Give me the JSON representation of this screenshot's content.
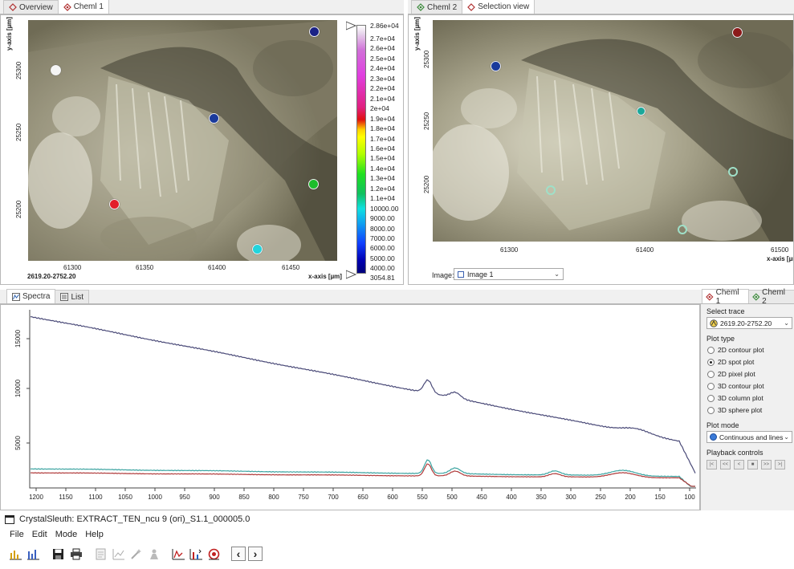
{
  "colors": {
    "dot_white": "#f4f4f4",
    "dot_navy": "#1b2286",
    "dot_blue": "#1a3a9c",
    "dot_green": "#1dbd2b",
    "dot_red": "#e21d2a",
    "dot_cyan": "#22d4dc",
    "dot_darkred": "#8c1a1a",
    "dot_teal": "#1aa89a",
    "ring": "#a7e7cf",
    "spectrum_top": "#4a4a78",
    "spectrum_teal": "#3aa3a0",
    "spectrum_red": "#b03a3a"
  },
  "left_panel": {
    "tabs": [
      {
        "label": "Overview",
        "icon": "overview-icon"
      },
      {
        "label": "Cheml 1",
        "icon": "chemical-icon"
      }
    ],
    "y_axis": {
      "label": "y-axis [µm]",
      "ticks": [
        "25300",
        "25250",
        "25200"
      ]
    },
    "x_axis": {
      "label": "x-axis [µm]",
      "ticks": [
        "61300",
        "61350",
        "61400",
        "61450"
      ]
    },
    "range_label": "2619.20-2752.20",
    "colorbar": {
      "labels": [
        "2.86e+04",
        "2.7e+04",
        "2.6e+04",
        "2.5e+04",
        "2.4e+04",
        "2.3e+04",
        "2.2e+04",
        "2.1e+04",
        "2e+04",
        "1.9e+04",
        "1.8e+04",
        "1.7e+04",
        "1.6e+04",
        "1.5e+04",
        "1.4e+04",
        "1.3e+04",
        "1.2e+04",
        "1.1e+04",
        "10000.00",
        "9000.00",
        "8000.00",
        "7000.00",
        "6000.00",
        "5000.00",
        "4000.00",
        "3054.81"
      ]
    }
  },
  "right_panel": {
    "tabs": [
      {
        "label": "Cheml 2",
        "icon": "chemical-icon"
      },
      {
        "label": "Selection view",
        "icon": "selection-icon"
      }
    ],
    "y_axis": {
      "label": "y-axis [µm]",
      "ticks": [
        "25300",
        "25250",
        "25200"
      ]
    },
    "x_axis": {
      "label": "x-axis [µm]",
      "ticks": [
        "61300",
        "61400",
        "61500"
      ]
    },
    "image_label": "Image:",
    "image_value": "Image 1"
  },
  "bottom_panel": {
    "tabs": [
      {
        "label": "Spectra",
        "icon": "spectra-icon"
      },
      {
        "label": "List",
        "icon": "list-icon"
      }
    ],
    "y_ticks": [
      "15000",
      "10000",
      "5000"
    ],
    "x_ticks": [
      "1200",
      "1150",
      "1100",
      "1050",
      "1000",
      "950",
      "900",
      "850",
      "800",
      "750",
      "700",
      "650",
      "600",
      "550",
      "500",
      "450",
      "400",
      "350",
      "300",
      "250",
      "200",
      "150",
      "100"
    ]
  },
  "side_panel": {
    "tabs": [
      {
        "label": "Cheml 1",
        "icon": "chemical-icon"
      },
      {
        "label": "Cheml 2",
        "icon": "chemical-icon"
      }
    ],
    "select_trace_label": "Select trace",
    "trace_value": "2619.20-2752.20",
    "plot_type_label": "Plot type",
    "plot_types": [
      "2D contour plot",
      "2D spot plot",
      "2D pixel plot",
      "3D contour plot",
      "3D column plot",
      "3D sphere plot"
    ],
    "selected_plot_type": "2D spot plot",
    "plot_mode_label": "Plot mode",
    "plot_mode_value": "Continuous and lines",
    "playback_label": "Playback controls",
    "playback_buttons": [
      "|<",
      "<<",
      "<",
      "■",
      ">>",
      ">|"
    ]
  },
  "app": {
    "title": "CrystalSleuth: EXTRACT_TEN_ncu 9 (ori)_S1.1_000005.0",
    "menu": [
      "File",
      "Edit",
      "Mode",
      "Help"
    ]
  }
}
